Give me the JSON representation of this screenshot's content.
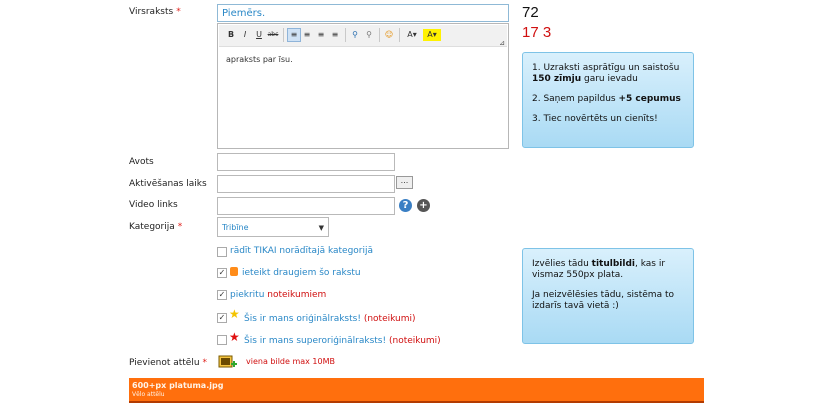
{
  "form": {
    "title_label": "Virsraksts",
    "title_placeholder": "Piemērs.",
    "required_mark": "*",
    "counter_main": "72",
    "counter_secondary": "17 3",
    "editor": {
      "toolbar": [
        "B",
        "I",
        "U",
        "abc",
        "align-left",
        "align-center",
        "align-right",
        "justify",
        "link",
        "unlink",
        "emoticon",
        "text-color",
        "highlight"
      ],
      "content": "apraksts par īsu."
    },
    "source_label": "Avots",
    "activation_label": "Aktivēšanas laiks",
    "activation_button": "...",
    "video_label": "Video links",
    "category_label": "Kategorija",
    "category_value": "Tribīne",
    "options": [
      {
        "checked": false,
        "text": "rādīt TIKAI norādītajā kategorijā"
      },
      {
        "checked": true,
        "text": "ieteikt draugiem šo rakstu"
      },
      {
        "checked": true,
        "text": "piekritu",
        "link": "noteikumiem"
      },
      {
        "checked": true,
        "text": "Šis ir mans oriģinālraksts!",
        "paren_open": "(",
        "link": "noteikumi",
        "paren_close": ")"
      },
      {
        "checked": false,
        "text": "Šis ir mans superoriģinālraksts!",
        "paren_open": "(",
        "link": "noteikumi",
        "paren_close": ")"
      }
    ],
    "image_label": "Pievienot attēlu",
    "image_hint": "viena bilde max 10MB",
    "upload_bar": {
      "line1": "600+px platuma.jpg",
      "line2": "Vēlo attēlu"
    }
  },
  "info_top": {
    "item1_a": "1. Uzraksti asprātīgu un saistošu",
    "item1_b_bold": "150 zīmju",
    "item1_b_rest": " garu ievadu",
    "item2_a": "2. Saņem papildus ",
    "item2_bold": "+5 cepumus",
    "item3": "3. Tiec novērtēts un cienīts!"
  },
  "info_bottom": {
    "p1_a": "Izvēlies tādu ",
    "p1_bold": "titulbildi",
    "p1_b": ", kas ir vismaz 550px plata.",
    "p2": "Ja neizvēlēsies tādu, sistēma to izdarīs tavā vietā :)"
  },
  "colors": {
    "accent_blue": "#2a88c7",
    "required_red": "#e0201b",
    "upload_orange": "#ff6f0d"
  }
}
